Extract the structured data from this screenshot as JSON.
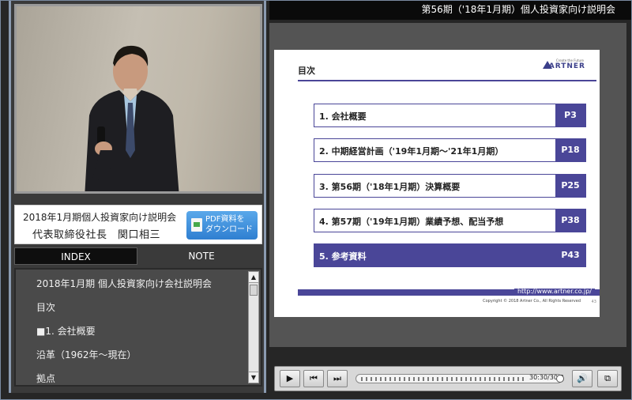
{
  "window": {
    "title": "第56期（'18年1月期）個人投資家向け説明会"
  },
  "presenter": {
    "event": "2018年1月期個人投資家向け説明会",
    "title_name": "代表取締役社長　関口相三",
    "pdf_button": "PDF資料を\nダウンロード"
  },
  "tabs": {
    "index": "INDEX",
    "note": "NOTE"
  },
  "index_list": [
    "2018年1月期 個人投資家向け会社説明会",
    "目次",
    "■1. 会社概要",
    "沿革（1962年～現在）",
    "拠点"
  ],
  "slide": {
    "heading": "目次",
    "logo": "ARTNER",
    "logo_tagline": "Create the Future",
    "toc": [
      {
        "label": "1. 会社概要",
        "page": "P3",
        "active": false
      },
      {
        "label": "2. 中期経営計画（'19年1月期～'21年1月期）",
        "page": "P18",
        "active": false
      },
      {
        "label": "3. 第56期（'18年1月期）決算概要",
        "page": "P25",
        "active": false
      },
      {
        "label": "4. 第57期（'19年1月期）業績予想、配当予想",
        "page": "P38",
        "active": false
      },
      {
        "label": "5. 参考資料",
        "page": "P43",
        "active": true
      }
    ],
    "url": "http://www.artner.co.jp/",
    "copyright": "Copyright © 2018 Artner Co., All Rights Reserved",
    "page_number": "43"
  },
  "player": {
    "time": "30:30/30:3",
    "progress": 0.98
  }
}
